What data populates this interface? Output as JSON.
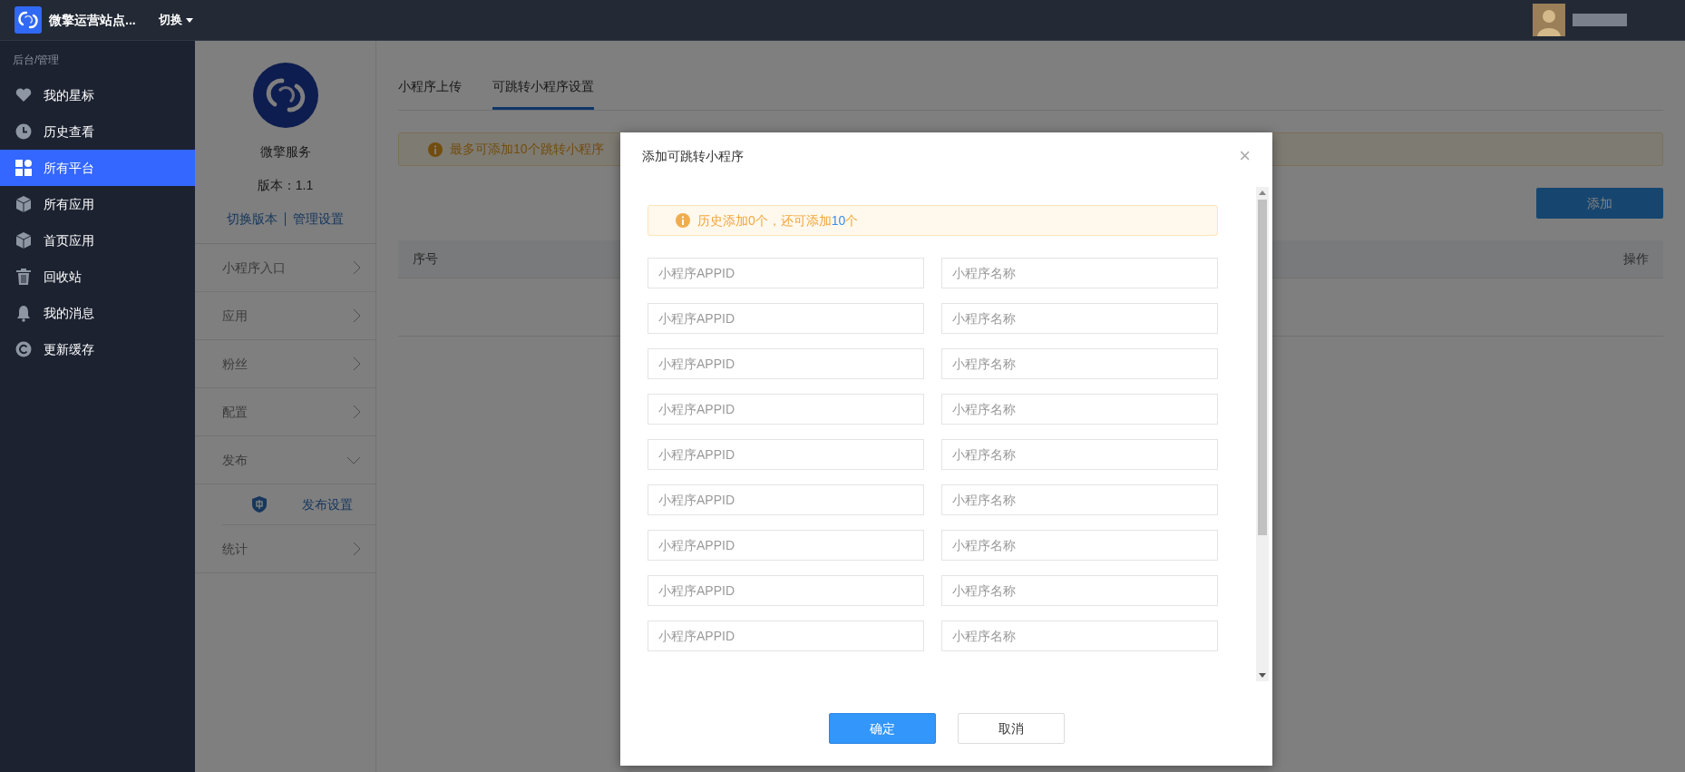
{
  "header": {
    "site_title": "微擎运营站点...",
    "switch_label": "切换"
  },
  "sidebar": {
    "section_label": "后台/管理",
    "items": [
      {
        "label": "我的星标",
        "kind": "heart",
        "selected": false
      },
      {
        "label": "历史查看",
        "kind": "clock",
        "selected": false
      },
      {
        "label": "所有平台",
        "kind": "grid",
        "selected": true
      },
      {
        "label": "所有应用",
        "kind": "cube",
        "selected": false
      },
      {
        "label": "首页应用",
        "kind": "cube",
        "selected": false
      },
      {
        "label": "回收站",
        "kind": "trash",
        "selected": false
      },
      {
        "label": "我的消息",
        "kind": "bell",
        "selected": false
      },
      {
        "label": "更新缓存",
        "kind": "refresh",
        "selected": false
      }
    ]
  },
  "app_panel": {
    "name": "微擎服务",
    "version": "版本：1.1",
    "links": [
      "切换版本",
      "管理设置"
    ],
    "menu": [
      {
        "label": "小程序入口",
        "expanded": false
      },
      {
        "label": "应用",
        "expanded": false
      },
      {
        "label": "粉丝",
        "expanded": false
      },
      {
        "label": "配置",
        "expanded": false
      },
      {
        "label": "发布",
        "expanded": true,
        "children": [
          {
            "label": "发布设置"
          }
        ]
      },
      {
        "label": "统计",
        "expanded": false
      }
    ]
  },
  "tabs": [
    {
      "label": "小程序上传",
      "selected": false
    },
    {
      "label": "可跳转小程序设置",
      "selected": true
    }
  ],
  "notice": "最多可添加10个跳转小程序",
  "add_button": "添加",
  "table": {
    "columns": [
      "序号",
      "操作"
    ]
  },
  "modal": {
    "title": "添加可跳转小程序",
    "close": "×",
    "alert": [
      {
        "text": "历史添加0个，还可添加",
        "kind": "plain"
      },
      {
        "text": "10",
        "kind": "highlight"
      },
      {
        "text": "个",
        "kind": "plain"
      }
    ],
    "rows": [
      {
        "appid_placeholder": "小程序APPID",
        "name_placeholder": "小程序名称"
      },
      {
        "appid_placeholder": "小程序APPID",
        "name_placeholder": "小程序名称"
      },
      {
        "appid_placeholder": "小程序APPID",
        "name_placeholder": "小程序名称"
      },
      {
        "appid_placeholder": "小程序APPID",
        "name_placeholder": "小程序名称"
      },
      {
        "appid_placeholder": "小程序APPID",
        "name_placeholder": "小程序名称"
      },
      {
        "appid_placeholder": "小程序APPID",
        "name_placeholder": "小程序名称"
      },
      {
        "appid_placeholder": "小程序APPID",
        "name_placeholder": "小程序名称"
      },
      {
        "appid_placeholder": "小程序APPID",
        "name_placeholder": "小程序名称"
      },
      {
        "appid_placeholder": "小程序APPID",
        "name_placeholder": "小程序名称"
      }
    ],
    "buttons": [
      {
        "label": "确定",
        "kind": "primary"
      },
      {
        "label": "取消",
        "kind": "secondary"
      }
    ]
  }
}
